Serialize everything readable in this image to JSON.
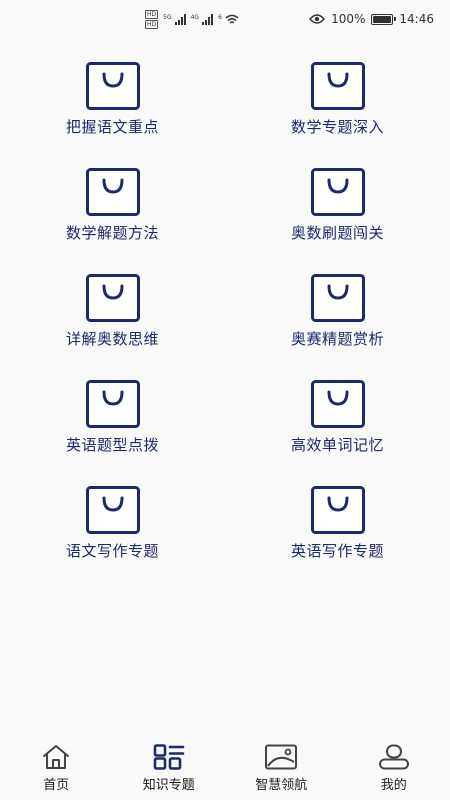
{
  "status_bar": {
    "sim1": "HD",
    "sim2": "HD",
    "net1": "5G",
    "net2": "4G",
    "wifi_num": "6",
    "battery": "100%",
    "time": "14:46"
  },
  "grid": {
    "items": [
      {
        "label": "把握语文重点"
      },
      {
        "label": "数学专题深入"
      },
      {
        "label": "数学解题方法"
      },
      {
        "label": "奥数刷题闯关"
      },
      {
        "label": "详解奥数思维"
      },
      {
        "label": "奥赛精题赏析"
      },
      {
        "label": "英语题型点拨"
      },
      {
        "label": "高效单词记忆"
      },
      {
        "label": "语文写作专题"
      },
      {
        "label": "英语写作专题"
      }
    ]
  },
  "bottom_nav": {
    "items": [
      {
        "label": "首页",
        "icon": "home-icon"
      },
      {
        "label": "知识专题",
        "icon": "grid-icon"
      },
      {
        "label": "智慧领航",
        "icon": "image-icon"
      },
      {
        "label": "我的",
        "icon": "profile-icon"
      }
    ],
    "active_index": 1
  },
  "colors": {
    "accent": "#1b2a6b",
    "background": "#f9f9f9"
  }
}
